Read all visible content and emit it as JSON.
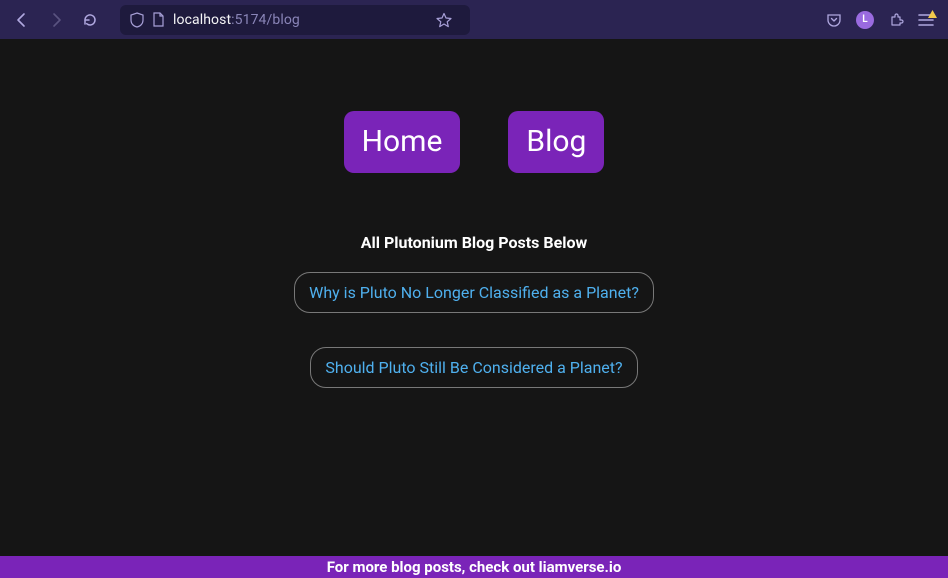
{
  "browser": {
    "url_host": "localhost",
    "url_port_path": ":5174/blog",
    "profile_letter": "L"
  },
  "nav": {
    "home": "Home",
    "blog": "Blog"
  },
  "heading": "All Plutonium Blog Posts Below",
  "posts": [
    "Why is Pluto No Longer Classified as a Planet?",
    "Should Pluto Still Be Considered a Planet?"
  ],
  "footer": "For more blog posts, check out liamverse.io",
  "colors": {
    "accent": "#7a24b8",
    "link": "#4fb0ee",
    "page_bg": "#151515",
    "chrome_bg": "#2b2452"
  }
}
